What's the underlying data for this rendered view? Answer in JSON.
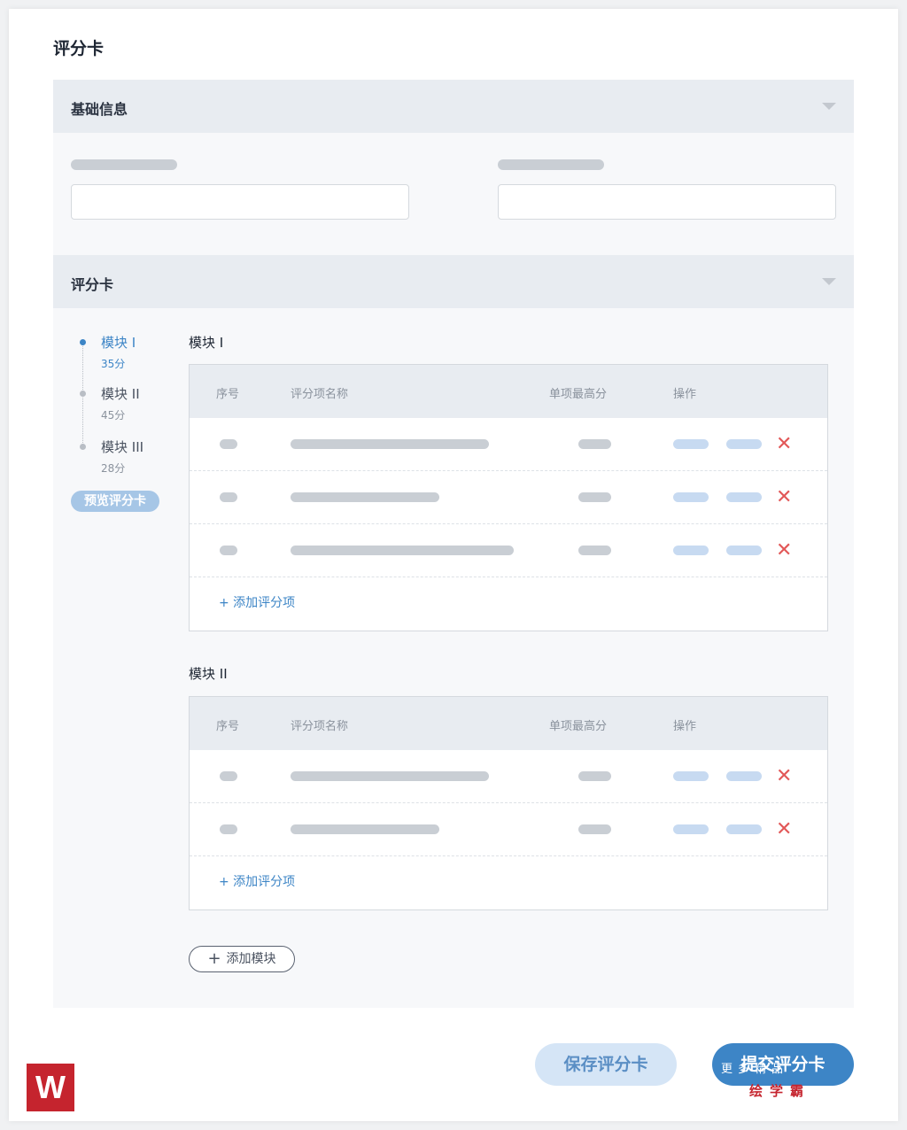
{
  "page": {
    "title": "评分卡"
  },
  "basic_info": {
    "header": "基础信息"
  },
  "scorecard": {
    "header": "评分卡",
    "nav": [
      {
        "name": "模块 I",
        "score": "35分",
        "active": true
      },
      {
        "name": "模块 II",
        "score": "45分",
        "active": false
      },
      {
        "name": "模块 III",
        "score": "28分",
        "active": false
      }
    ],
    "preview_label": "预览评分卡",
    "columns": {
      "index": "序号",
      "name": "评分项名称",
      "max": "单项最高分",
      "actions": "操作"
    },
    "modules": [
      {
        "title": "模块 I",
        "add_item_label": "+ 添加评分项"
      },
      {
        "title": "模块 II",
        "add_item_label": "+ 添加评分项"
      }
    ],
    "add_module_label": "添加模块"
  },
  "footer": {
    "save_label": "保存评分卡",
    "submit_label": "提交评分卡"
  },
  "icons": {
    "delete": "close-icon",
    "plus": "plus-icon",
    "caret": "chevron-down-icon"
  },
  "colors": {
    "accent": "#3d85c6",
    "danger": "#e25858",
    "skeleton": "#c9ced4",
    "skeleton_blue": "#c7daf1"
  },
  "branding": {
    "logo_letter": "W",
    "watermark_top": "更多精品",
    "watermark_bottom": "绘学霸"
  }
}
